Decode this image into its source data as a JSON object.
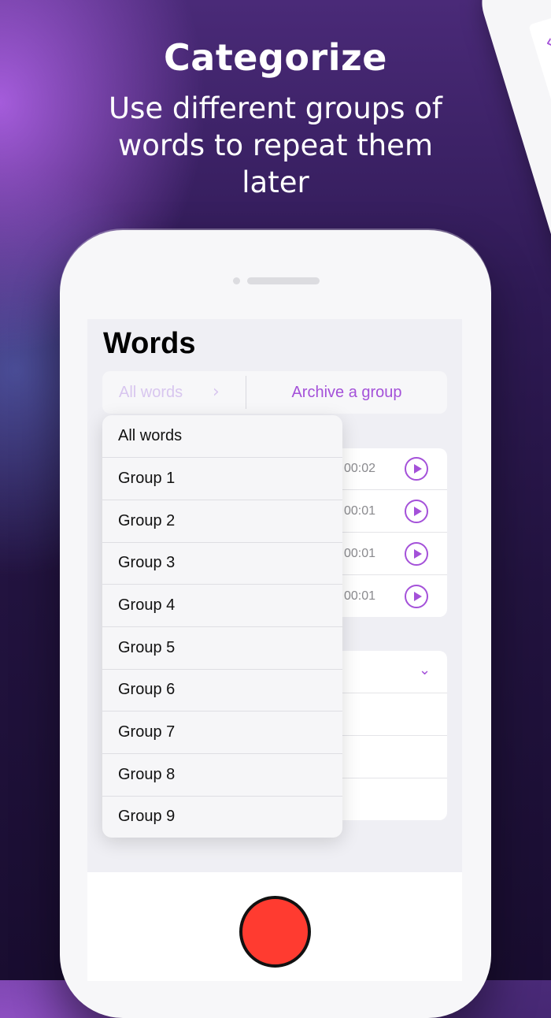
{
  "promo": {
    "headline": "Categorize",
    "subheadline": "Use different groups of words to repeat them later"
  },
  "back_phone": {
    "nav_back_label": "V"
  },
  "screen": {
    "title": "Words",
    "segment": {
      "filter_label": "All words",
      "archive_label": "Archive a group"
    },
    "recordings": [
      {
        "duration": "00:02"
      },
      {
        "duration": "00:01"
      },
      {
        "duration": "00:01"
      },
      {
        "duration": "00:01"
      }
    ],
    "group_dropdown": {
      "options": [
        "All words",
        "Group 1",
        "Group 2",
        "Group 3",
        "Group 4",
        "Group 5",
        "Group 6",
        "Group 7",
        "Group 8",
        "Group 9"
      ]
    }
  },
  "colors": {
    "accent": "#a451d9",
    "record": "#ff3b30"
  }
}
